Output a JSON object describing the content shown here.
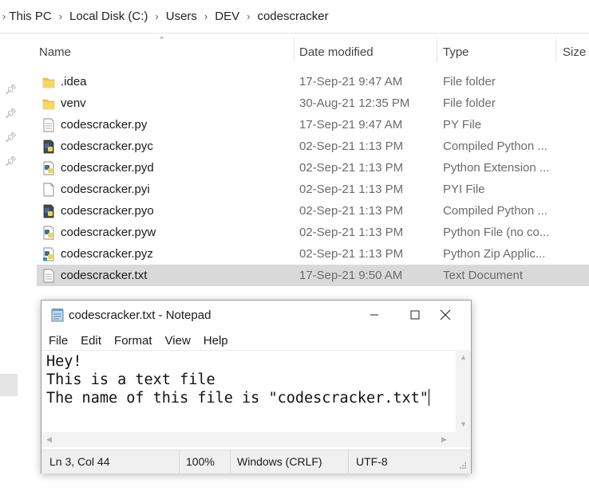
{
  "breadcrumb": {
    "items": [
      "This PC",
      "Local Disk (C:)",
      "Users",
      "DEV",
      "codescracker"
    ],
    "separator": ">"
  },
  "columns": {
    "name": "Name",
    "date_modified": "Date modified",
    "type": "Type",
    "size": "Size"
  },
  "files": [
    {
      "name": ".idea",
      "date": "17-Sep-21 9:47 AM",
      "type": "File folder",
      "icon": "folder-icon"
    },
    {
      "name": "venv",
      "date": "30-Aug-21 12:35 PM",
      "type": "File folder",
      "icon": "folder-icon"
    },
    {
      "name": "codescracker.py",
      "date": "17-Sep-21 9:47 AM",
      "type": "PY File",
      "icon": "text-file-icon"
    },
    {
      "name": "codescracker.pyc",
      "date": "02-Sep-21 1:13 PM",
      "type": "Compiled Python ...",
      "icon": "python-compiled-icon"
    },
    {
      "name": "codescracker.pyd",
      "date": "02-Sep-21 1:13 PM",
      "type": "Python Extension ...",
      "icon": "python-extension-icon"
    },
    {
      "name": "codescracker.pyi",
      "date": "02-Sep-21 1:13 PM",
      "type": "PYI File",
      "icon": "blank-file-icon"
    },
    {
      "name": "codescracker.pyo",
      "date": "02-Sep-21 1:13 PM",
      "type": "Compiled Python ...",
      "icon": "python-compiled-icon"
    },
    {
      "name": "codescracker.pyw",
      "date": "02-Sep-21 1:13 PM",
      "type": "Python File (no co...",
      "icon": "python-file-icon"
    },
    {
      "name": "codescracker.pyz",
      "date": "02-Sep-21 1:13 PM",
      "type": "Python Zip Applic...",
      "icon": "python-zip-icon"
    },
    {
      "name": "codescracker.txt",
      "date": "17-Sep-21 9:50 AM",
      "type": "Text Document",
      "icon": "text-file-icon",
      "selected": true
    }
  ],
  "notepad": {
    "title": "codescracker.txt - Notepad",
    "menu": [
      "File",
      "Edit",
      "Format",
      "View",
      "Help"
    ],
    "lines": [
      "Hey!",
      "This is a text file",
      "The name of this file is \"codescracker.txt\""
    ],
    "status": {
      "position": "Ln 3, Col 44",
      "zoom": "100%",
      "line_ending": "Windows (CRLF)",
      "encoding": "UTF-8"
    }
  },
  "colors": {
    "selected_row": "#d9d9d9",
    "folder": "#f0c542",
    "python_blue": "#3a6fa5",
    "python_yellow": "#f5d347"
  }
}
